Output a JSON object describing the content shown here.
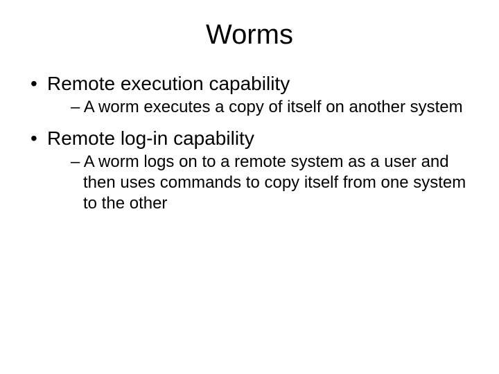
{
  "title": "Worms",
  "bullets": [
    {
      "text": "Remote execution capability",
      "sub": [
        "A worm executes a copy of itself on another system"
      ]
    },
    {
      "text": "Remote log-in capability",
      "sub": [
        "A worm logs on to a remote system as a user and then uses commands to copy itself from one system to the other"
      ]
    }
  ]
}
